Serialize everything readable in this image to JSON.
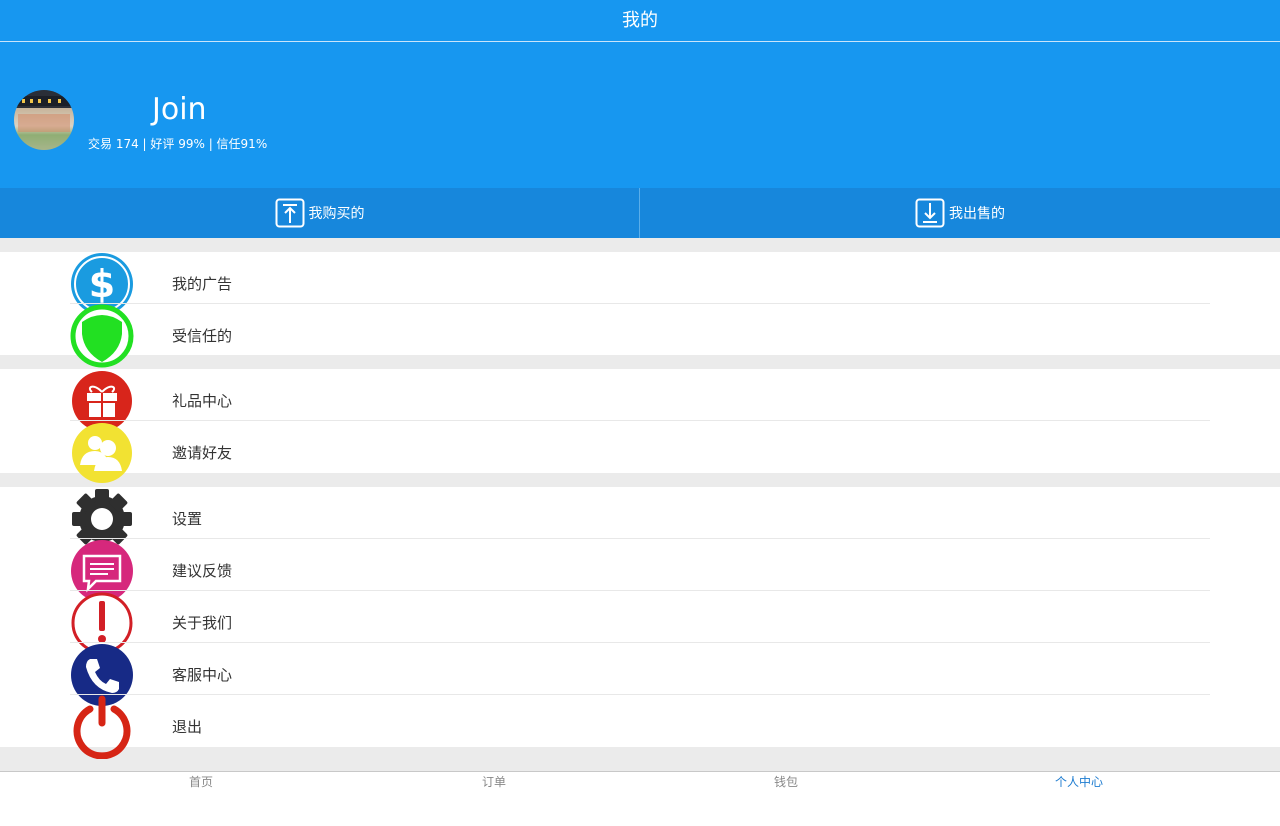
{
  "header": {
    "title": "我的"
  },
  "profile": {
    "name": "Join",
    "stats": "交易 174 | 好评 99% | 信任91%"
  },
  "tabs": [
    {
      "label": "我购买的",
      "icon": "upload-box-icon"
    },
    {
      "label": "我出售的",
      "icon": "download-box-icon"
    }
  ],
  "menu": {
    "ads": {
      "label": "我的广告",
      "icon": "dollar-icon",
      "color": "#1a9be0"
    },
    "trusted": {
      "label": "受信任的",
      "icon": "shield-icon",
      "color": "#22e022"
    },
    "gifts": {
      "label": "礼品中心",
      "icon": "gift-icon",
      "color": "#d8251b"
    },
    "invite": {
      "label": "邀请好友",
      "icon": "friends-icon",
      "color": "#f2e232"
    },
    "settings": {
      "label": "设置",
      "icon": "gear-icon",
      "color": "#2f2f2f"
    },
    "feedback": {
      "label": "建议反馈",
      "icon": "message-icon",
      "color": "#d6287c"
    },
    "about": {
      "label": "关于我们",
      "icon": "exclamation-icon",
      "color": "#d21f26"
    },
    "service": {
      "label": "客服中心",
      "icon": "phone-icon",
      "color": "#172a86"
    },
    "logout": {
      "label": "退出",
      "icon": "power-icon",
      "color": "#d62515"
    }
  },
  "bottom_nav": [
    {
      "label": "首页",
      "active": false
    },
    {
      "label": "订单",
      "active": false
    },
    {
      "label": "钱包",
      "active": false
    },
    {
      "label": "个人中心",
      "active": true
    }
  ]
}
